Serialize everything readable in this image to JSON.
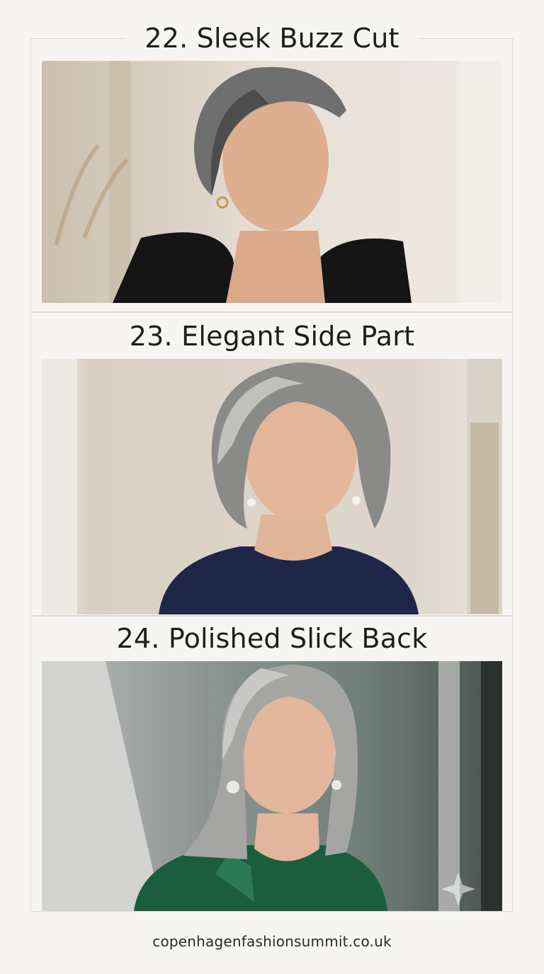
{
  "sections": [
    {
      "title": "22. Sleek Buzz Cut",
      "image_alt": "Woman with short grey pixie cut wearing black blazer"
    },
    {
      "title": "23. Elegant Side Part",
      "image_alt": "Woman with grey side-parted bob wearing navy sweater"
    },
    {
      "title": "24. Polished Slick Back",
      "image_alt": "Woman with long grey hair wearing green silk blouse"
    }
  ],
  "footer": {
    "site": "copenhagenfashionsummit.co.uk"
  },
  "colors": {
    "background": "#f6f5f1",
    "frame": "#dcd9d2",
    "text": "#1e1e1e"
  },
  "icons": [
    "sparkle-icon"
  ]
}
